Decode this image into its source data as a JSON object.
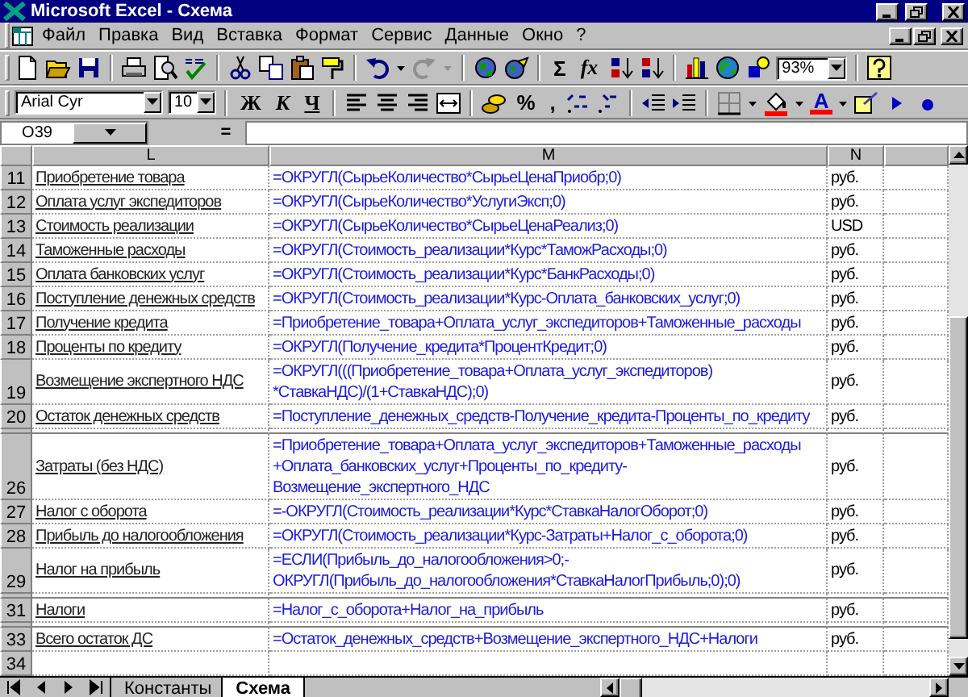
{
  "window": {
    "title": "Microsoft Excel - Схема"
  },
  "menu": [
    "Файл",
    "Правка",
    "Вид",
    "Вставка",
    "Формат",
    "Сервис",
    "Данные",
    "Окно",
    "?"
  ],
  "standard_toolbar": {
    "sum_label": "Σ",
    "function_label": "fx",
    "zoom": "93%"
  },
  "formatting_toolbar": {
    "font": "Arial Cyr",
    "size": "10",
    "bold_label": "Ж",
    "italic_label": "К",
    "underline_label": "Ч",
    "percent_label": "%",
    "comma_label": ",",
    "font_color_label": "A"
  },
  "formula_bar": {
    "name_box": "O39",
    "equals_label": "="
  },
  "columns": [
    "L",
    "M",
    "N"
  ],
  "rows": [
    {
      "kind": "row",
      "number": "11",
      "label": "Приобретение товара",
      "formula": [
        "=ОКРУГЛ(СырьеКоличество*СырьеЦенаПриобр;0)"
      ],
      "unit": "руб."
    },
    {
      "kind": "row",
      "number": "12",
      "label": "Оплата услуг экспедиторов",
      "formula": [
        "=ОКРУГЛ(СырьеКоличество*УслугиЭксп;0)"
      ],
      "unit": "руб."
    },
    {
      "kind": "row",
      "number": "13",
      "label": "Стоимость реализации",
      "formula": [
        "=ОКРУГЛ(СырьеКоличество*СырьеЦенаРеализ;0)"
      ],
      "unit": "USD"
    },
    {
      "kind": "row",
      "number": "14",
      "label": "Таможенные расходы",
      "formula": [
        "=ОКРУГЛ(Стоимость_реализации*Курс*ТаможРасходы;0)"
      ],
      "unit": "руб."
    },
    {
      "kind": "row",
      "number": "15",
      "label": "Оплата банковских услуг",
      "formula": [
        "=ОКРУГЛ(Стоимость_реализации*Курс*БанкРасходы;0)"
      ],
      "unit": "руб."
    },
    {
      "kind": "row",
      "number": "16",
      "label": "Поступление денежных средств",
      "formula": [
        "=ОКРУГЛ(Стоимость_реализации*Курс-Оплата_банковских_услуг;0)"
      ],
      "unit": "руб."
    },
    {
      "kind": "row",
      "number": "17",
      "label": "Получение кредита",
      "formula": [
        "=Приобретение_товара+Оплата_услуг_экспедиторов+Таможенные_расходы"
      ],
      "unit": "руб."
    },
    {
      "kind": "row",
      "number": "18",
      "label": "Проценты по кредиту",
      "formula": [
        "=ОКРУГЛ(Получение_кредита*ПроцентКредит;0)"
      ],
      "unit": "руб."
    },
    {
      "kind": "row",
      "number": "19",
      "label": "Возмещение экспертного НДС",
      "formula": [
        "=ОКРУГЛ(((Приобретение_товара+Оплата_услуг_экспедиторов)",
        "*СтавкаНДС)/(1+СтавкаНДС);0)"
      ],
      "unit": "руб."
    },
    {
      "kind": "row",
      "number": "20",
      "label": "Остаток денежных средств",
      "formula": [
        "=Поступление_денежных_средств-Получение_кредита-Проценты_по_кредиту"
      ],
      "unit": "руб."
    },
    {
      "kind": "collapsed"
    },
    {
      "kind": "row",
      "number": "26",
      "label": "Затраты (без НДС)",
      "formula": [
        "=Приобретение_товара+Оплата_услуг_экспедиторов+Таможенные_расходы",
        "+Оплата_банковских_услуг+Проценты_по_кредиту-",
        "Возмещение_экспертного_НДС"
      ],
      "unit": "руб."
    },
    {
      "kind": "row",
      "number": "27",
      "label": "Налог с оборота",
      "formula": [
        "=-ОКРУГЛ(Стоимость_реализации*Курс*СтавкаНалогОборот;0)"
      ],
      "unit": "руб."
    },
    {
      "kind": "row",
      "number": "28",
      "label": "Прибыль до налогообложения",
      "formula": [
        "=ОКРУГЛ(Стоимость_реализации*Курс-Затраты+Налог_с_оборота;0)"
      ],
      "unit": "руб."
    },
    {
      "kind": "row",
      "number": "29",
      "label": "Налог на прибыль",
      "formula": [
        "=ЕСЛИ(Прибыль_до_налогообложения>0;-",
        "ОКРУГЛ(Прибыль_до_налогообложения*СтавкаНалогПрибыль;0);0)"
      ],
      "unit": "руб."
    },
    {
      "kind": "collapsed"
    },
    {
      "kind": "row",
      "number": "31",
      "label": "Налоги",
      "formula": [
        "=Налог_с_оборота+Налог_на_прибыль"
      ],
      "unit": "руб."
    },
    {
      "kind": "collapsed"
    },
    {
      "kind": "row",
      "number": "33",
      "label": "Всего остаток ДС",
      "formula": [
        "=Остаток_денежных_средств+Возмещение_экспертного_НДС+Налоги"
      ],
      "unit": "руб."
    },
    {
      "kind": "row",
      "number": "34"
    }
  ],
  "sheet_tabs": [
    {
      "label": "Константы",
      "selected": false
    },
    {
      "label": "Схема",
      "selected": true
    }
  ]
}
